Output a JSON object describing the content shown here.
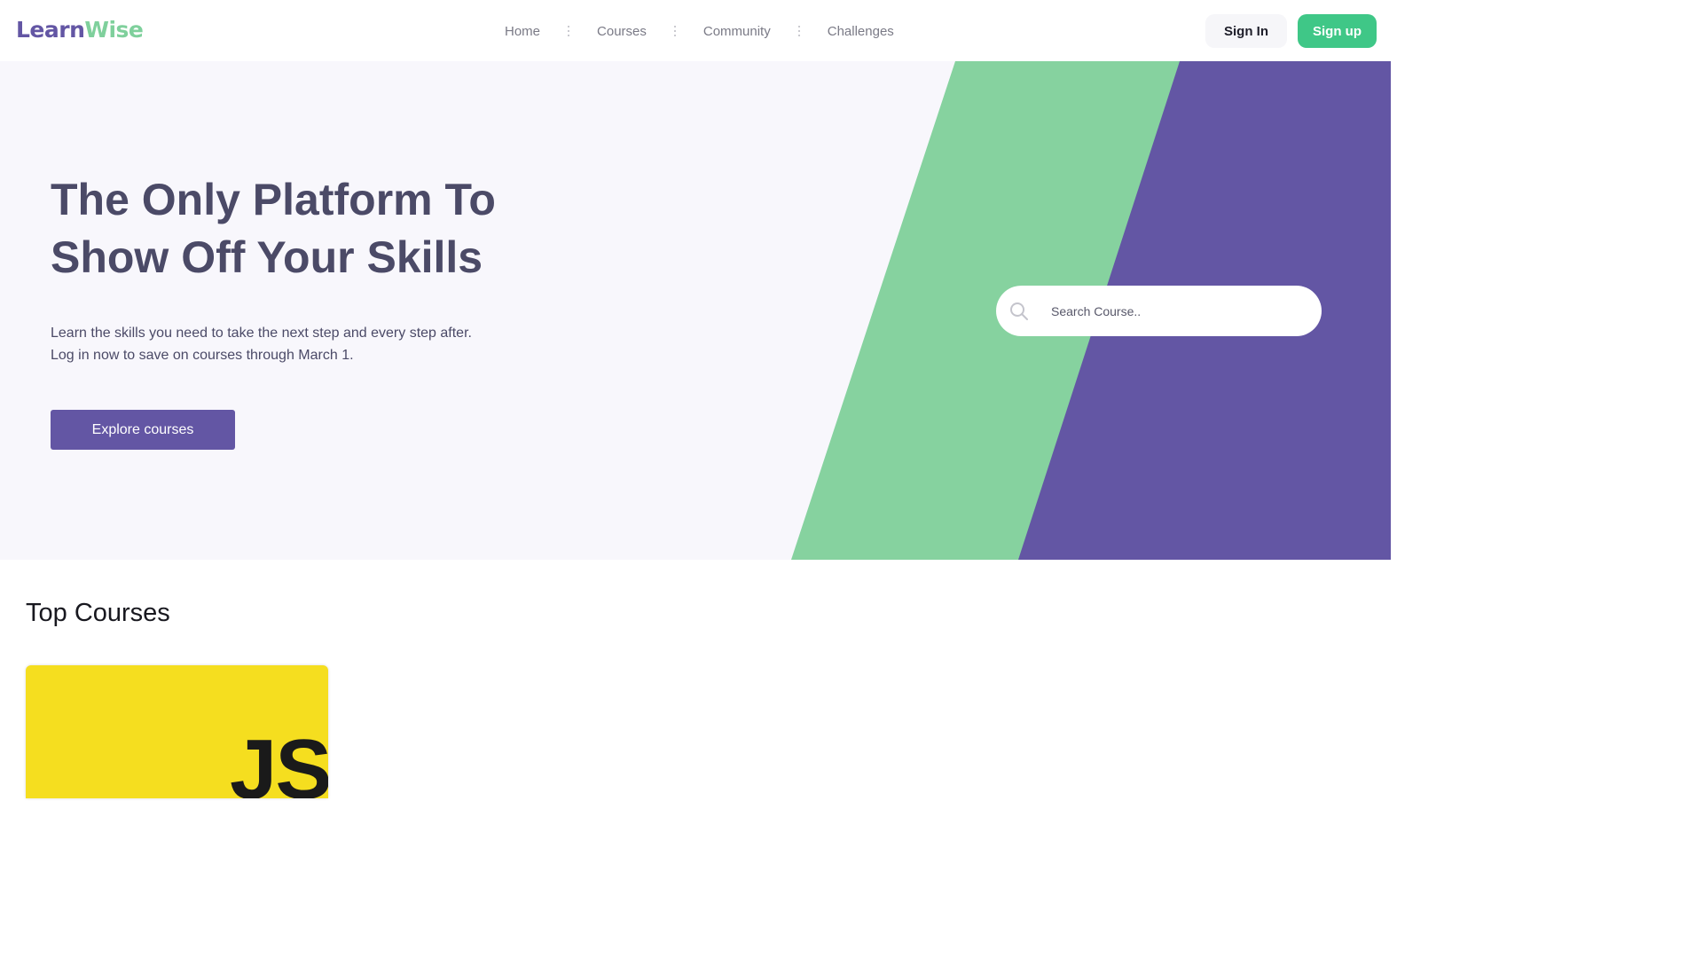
{
  "brand": {
    "name_part1": "Learn",
    "name_part2": "Wise",
    "primary_color": "#6356a4",
    "accent_color": "#7fd09c",
    "signup_color": "#3fc787"
  },
  "nav": {
    "items": [
      {
        "label": "Home"
      },
      {
        "label": "Courses"
      },
      {
        "label": "Community"
      },
      {
        "label": "Challenges"
      }
    ]
  },
  "auth": {
    "sign_in_label": "Sign In",
    "sign_up_label": "Sign up"
  },
  "hero": {
    "title_line1": "The Only Platform To",
    "title_line2": "Show Off Your Skills",
    "description": "Learn the skills you need to take the next step and every step after. Log in now to save on courses through March 1.",
    "cta_label": "Explore courses",
    "search": {
      "placeholder": "Search Course..",
      "icon": "search-icon"
    }
  },
  "top_courses": {
    "title": "Top Courses",
    "courses": [
      {
        "logo_text": "JS",
        "color": "#f5de1f"
      }
    ]
  }
}
